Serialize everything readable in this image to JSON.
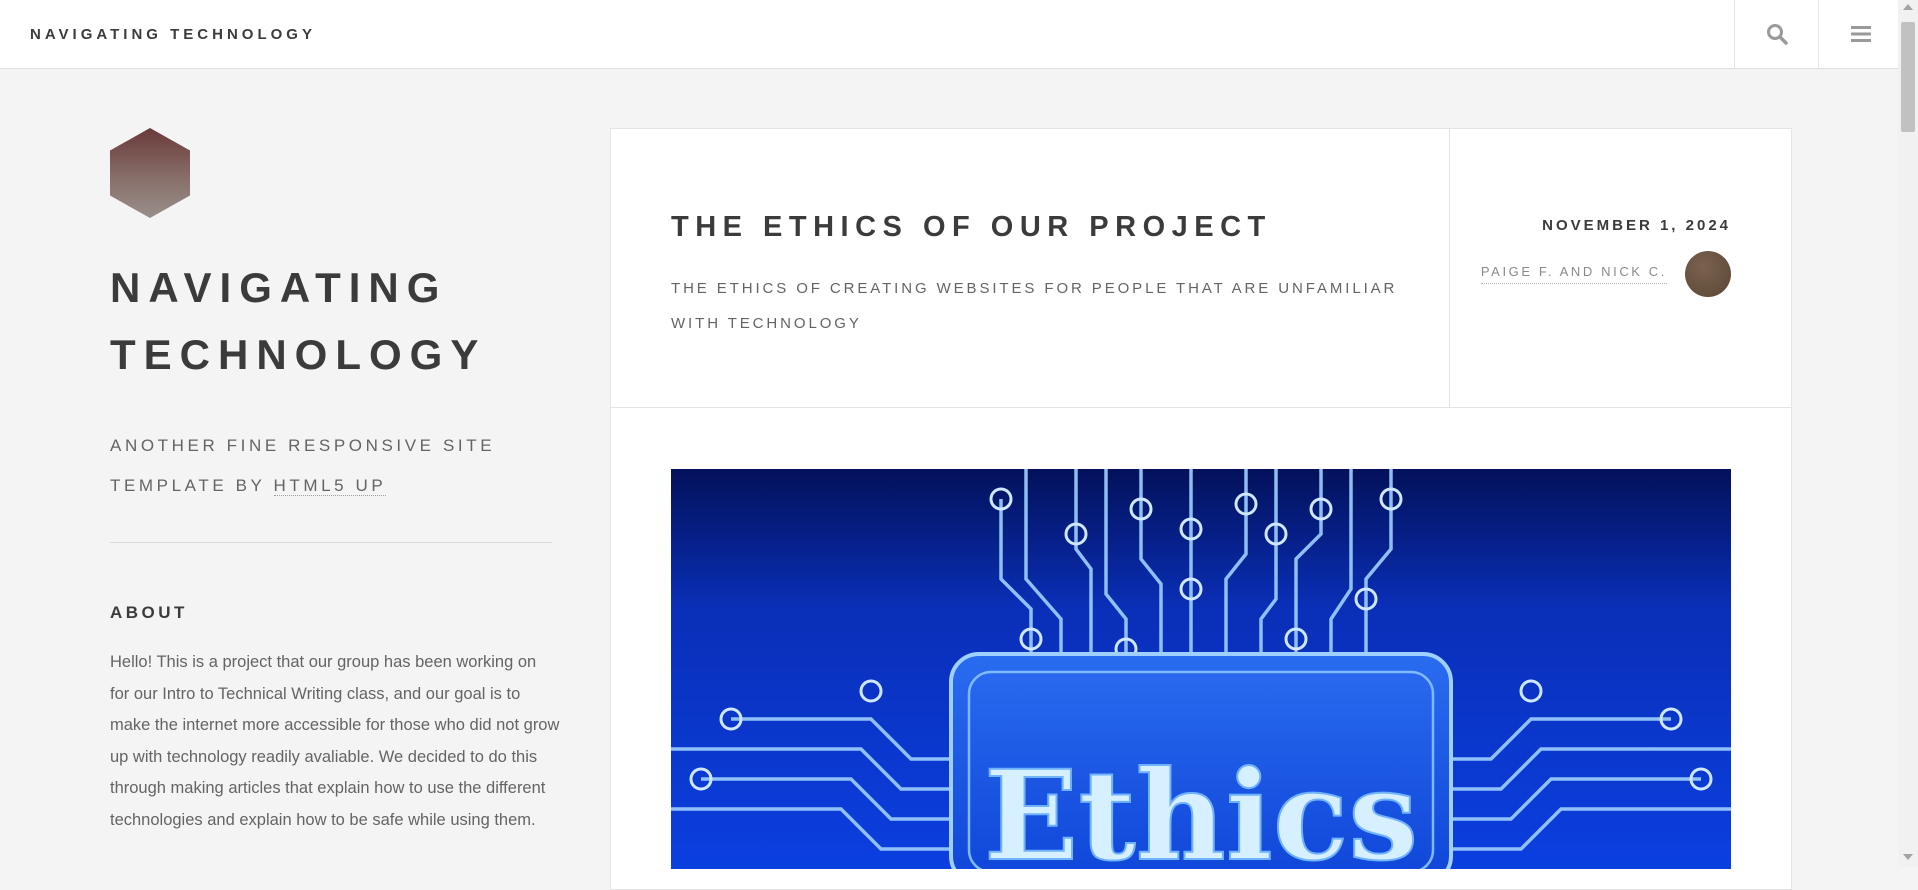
{
  "topbar": {
    "brand": "NAVIGATING TECHNOLOGY",
    "search_icon": "search-icon",
    "menu_icon": "menu-icon"
  },
  "sidebar": {
    "logo_icon": "hexagon-logo",
    "title": "NAVIGATING TECHNOLOGY",
    "subtitle_prefix": "ANOTHER FINE RESPONSIVE SITE TEMPLATE BY ",
    "subtitle_link": "HTML5 UP",
    "about_heading": "ABOUT",
    "about_text": "Hello! This is a project that our group has been working on for our Intro to Technical Writing class, and our goal is to make the internet more accessible for those who did not grow up with technology readily avaliable. We decided to do this through making articles that explain how to use the different technologies and explain how to be safe while using them."
  },
  "article": {
    "title": "THE ETHICS OF OUR PROJECT",
    "subtitle": "THE ETHICS OF CREATING WEBSITES FOR PEOPLE THAT ARE UNFAMILIAR WITH TECHNOLOGY",
    "date": "NOVEMBER 1, 2024",
    "author": "PAIGE F. AND NICK C.",
    "image_text": "Ethics"
  },
  "colors": {
    "background": "#f4f4f4",
    "text": "#3c3b3b",
    "muted": "#646464",
    "image_blue": "#0a3ad0"
  }
}
